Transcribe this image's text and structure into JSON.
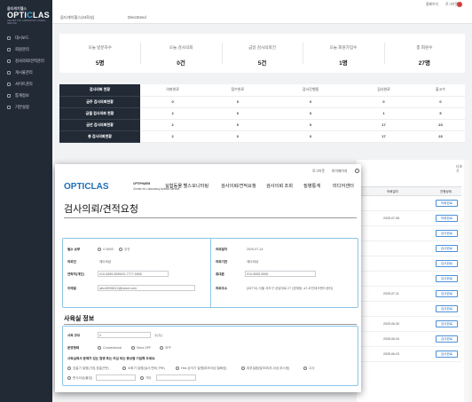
{
  "sidebar": {
    "logo_sub": "옵티캐치헬스",
    "logo_main_pre": "OPTI",
    "logo_main_o": "C",
    "logo_main_post": "LAS",
    "logo_tag": "CENTER FOR LABORATORY ANIMAL SERVICE",
    "items": [
      {
        "label": "대시보드",
        "icon": "dashboard-icon"
      },
      {
        "label": "회원관리",
        "icon": "users-icon"
      },
      {
        "label": "검사의뢰/견적관리",
        "icon": "clipboard-icon"
      },
      {
        "label": "게시물관리",
        "icon": "document-icon"
      },
      {
        "label": "사이트관리",
        "icon": "settings-icon"
      },
      {
        "label": "통계정보",
        "icon": "chart-icon"
      },
      {
        "label": "기본설정",
        "icon": "gear-icon"
      }
    ]
  },
  "topbar": {
    "crumb1": "옵티캐치헬스(24화실)",
    "crumb2": "DirectSend",
    "link1": "홈페이지",
    "link2": "로그아웃"
  },
  "stats": [
    {
      "label": "오늘 방문자수",
      "value": "5명"
    },
    {
      "label": "오늘 검사의뢰",
      "value": "0건"
    },
    {
      "label": "금일 검사의뢰건",
      "value": "5건"
    },
    {
      "label": "오늘 회원가입수",
      "value": "1명"
    },
    {
      "label": "총 회원수",
      "value": "27명"
    }
  ],
  "status_table": {
    "corner": "검사의뢰 현황",
    "headers": [
      "의뢰완료",
      "접수완료",
      "검사진행중",
      "검사완료",
      "출고수"
    ],
    "rows": [
      {
        "label": "금주 검사의뢰현황",
        "values": [
          "0",
          "0",
          "0",
          "0",
          "0"
        ]
      },
      {
        "label": "금월 검사의뢰 현황",
        "values": [
          "2",
          "0",
          "0",
          "1",
          "5"
        ]
      },
      {
        "label": "금년 검사의뢰현황",
        "values": [
          "2",
          "0",
          "0",
          "17",
          "23"
        ]
      },
      {
        "label": "총 검사의뢰현황",
        "values": [
          "2",
          "0",
          "0",
          "17",
          "23"
        ]
      }
    ]
  },
  "background_list": {
    "more": "더보기",
    "col_date": "의뢰일자",
    "col_status": "진행상태",
    "rows": [
      {
        "date": "",
        "status": "의뢰완료"
      },
      {
        "date": "2025-07-08",
        "status": "의뢰완료"
      },
      {
        "date": "",
        "status": "검사완료"
      },
      {
        "date": "",
        "status": "검사완료"
      },
      {
        "date": "",
        "status": "검사완료"
      },
      {
        "date": "",
        "status": "검사완료"
      },
      {
        "date": "2025-07-11",
        "status": "검사완료"
      },
      {
        "date": "",
        "status": "검사완료"
      },
      {
        "date": "2025-06-30",
        "status": "검사완료"
      },
      {
        "date": "2025-06-04",
        "status": "검사완료"
      },
      {
        "date": "2025-06-03",
        "status": "검사완료"
      }
    ]
  },
  "overlay": {
    "top_links": [
      "로그아웃",
      "마이페이지"
    ],
    "logo": "OPTICLAS",
    "logo_sub1": "OPTIPHARM",
    "logo_sub2": "Center for Laboratory Animal Service",
    "nav": [
      "실험동물 헬스모니터링",
      "검사의뢰/견적요청",
      "검사의뢰 조회",
      "질병통계",
      "미디어센터"
    ],
    "title": "검사의뢰/견적요청",
    "form_left": {
      "row1_label": "필수 송부",
      "row1_opt1": "O 8000",
      "row1_opt2": "무관",
      "row2_label": "의뢰인",
      "row2_value": "제이비샵",
      "row3_label": "연락처(개인)",
      "row3_value": "010-5555-5555/02-7777-5555",
      "row4_label": "이메일",
      "row4_value": "abc45998212@naver.com"
    },
    "form_right": {
      "row1_label": "의뢰일자",
      "row1_value": "2025-07-14",
      "row2_label": "의뢰기관",
      "row2_value": "제이비샵",
      "row3_label": "휴대폰",
      "row3_value": "010-5555-5555",
      "row4_label": "의뢰주소",
      "row4_value": "(06774) 서울 서초구 강남대로 27 (양재동, aT-코인테크랜드센터)"
    },
    "section2_title": "사육실 정보",
    "sec2": {
      "row1_label": "사육 규모",
      "row1_value": "0",
      "row1_unit": "수(두)",
      "row2_label": "운영형태",
      "row2_opts": [
        "Conventional",
        "Semi-SPF",
        "SPF"
      ],
      "row3_label": "사육실에서 문제가 있는 질병 또는 의심 되는 증상을 기입해 주세요.",
      "checks": [
        "호흡기 질병(기침,호흡곤란)",
        "소화기 질병(설사,변비,구토)",
        "Hbs 궁극기 질병(피모이상,털빠짐)",
        "피부질환(탈모/피부,이상,부스럼)",
        "번식이상(불임)",
        "고사"
      ],
      "check_tail": "기타"
    }
  }
}
